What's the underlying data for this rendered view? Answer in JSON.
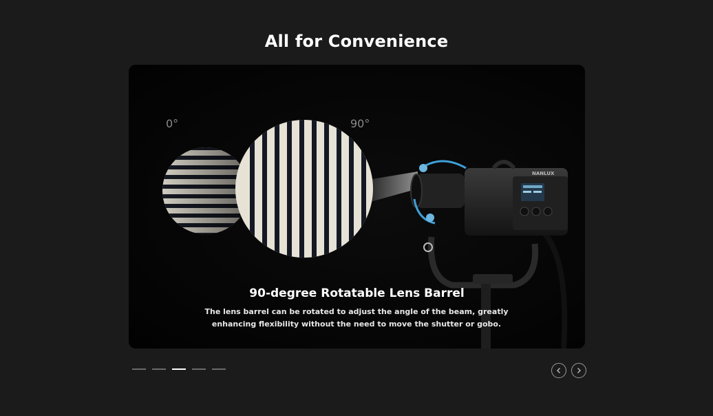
{
  "section": {
    "title": "All for Convenience"
  },
  "slide": {
    "label_left": "0°",
    "label_right": "90°",
    "caption_title": "90-degree Rotatable Lens Barrel",
    "caption_text": "The lens barrel can be rotated to adjust the angle of the beam, greatly enhancing flexibility without the need to move the shutter or gobo.",
    "brand_mark": "NANLUX"
  },
  "pagination": {
    "count": 5,
    "active_index": 2
  },
  "navigation": {
    "prev_icon": "chevron-left-icon",
    "next_icon": "chevron-right-icon"
  },
  "colors": {
    "background": "#1b1b1b",
    "accent_blue": "#3fa0d8"
  }
}
